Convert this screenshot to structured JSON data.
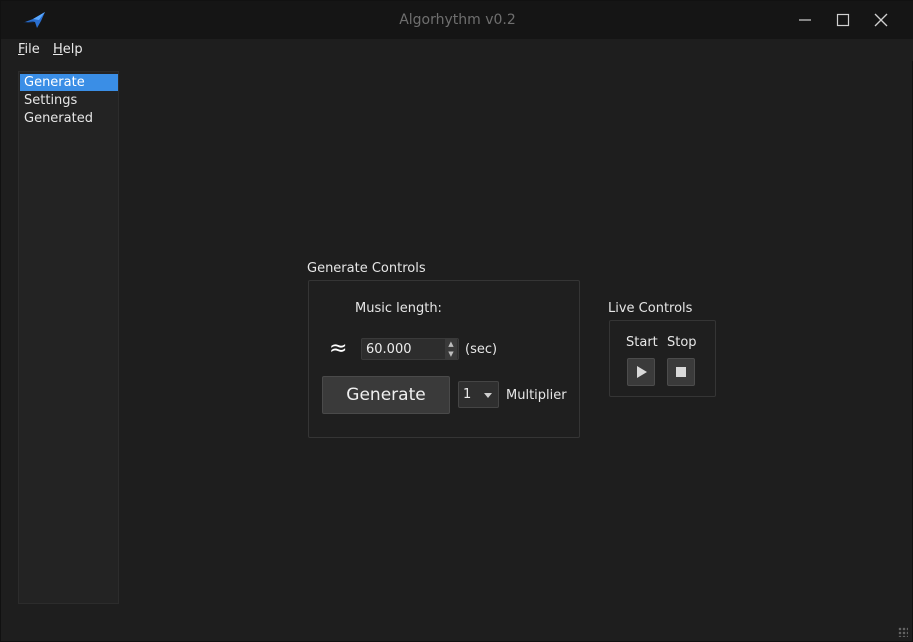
{
  "window": {
    "title": "Algorhythm v0.2",
    "icons": {
      "app": "bird-logo-icon",
      "minimize": "minimize-icon",
      "maximize": "maximize-icon",
      "close": "close-icon"
    }
  },
  "menu": {
    "file": {
      "prefix": "F",
      "rest": "ile"
    },
    "help": {
      "prefix": "H",
      "rest": "elp"
    }
  },
  "sidebar": {
    "items": [
      {
        "label": "Generate",
        "selected": true
      },
      {
        "label": "Settings",
        "selected": false
      },
      {
        "label": "Generated",
        "selected": false
      }
    ]
  },
  "generate_controls": {
    "title": "Generate Controls",
    "music_length_label": "Music length:",
    "approx_symbol": "≈",
    "length_value": "60.000",
    "unit_label": "(sec)",
    "generate_button": "Generate",
    "multiplier_value": "1",
    "multiplier_label": "Multiplier"
  },
  "live_controls": {
    "title": "Live Controls",
    "start_label": "Start",
    "stop_label": "Stop"
  },
  "colors": {
    "selection": "#3a8ee6",
    "background": "#1e1e1e"
  }
}
